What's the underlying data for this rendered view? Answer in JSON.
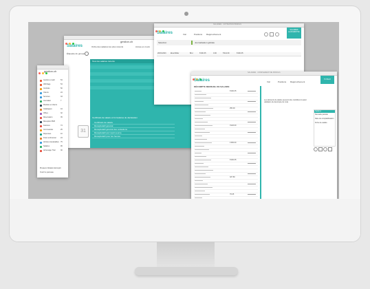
{
  "bg_color": "#e8e8e8",
  "accent": "#2fb5ad",
  "sidebar": {
    "logo": "gestion.ch",
    "items": [
      {
        "label": "Gestion et salir",
        "color": "#e8522d",
        "count": "54"
      },
      {
        "label": "Affichage",
        "color": "#e8522d",
        "count": "54"
      },
      {
        "label": "Contrats",
        "color": "#f39c12",
        "count": "50"
      },
      {
        "label": "Clients",
        "color": "#3498db",
        "count": "24"
      },
      {
        "label": "Services",
        "color": "#3498db",
        "count": "33"
      },
      {
        "label": "Journalier",
        "color": "#27ae60",
        "count": "7"
      },
      {
        "label": "Modules et clients",
        "color": "#2c3e50",
        "count": ""
      },
      {
        "label": "Catalogues",
        "color": "#e67e22",
        "count": "44"
      },
      {
        "label": "Offres",
        "color": "#9b59b6",
        "count": "32"
      },
      {
        "label": "Réservation",
        "color": "#e74c3c",
        "count": "35"
      },
      {
        "label": "Réception BVR",
        "color": "#2c3e50",
        "count": ""
      },
      {
        "label": "Factures",
        "color": "#e74c3c",
        "count": "74"
      },
      {
        "label": "Commandes",
        "color": "#f39c12",
        "count": "25"
      },
      {
        "label": "Dépenses",
        "color": "#16a085",
        "count": "10"
      },
      {
        "label": "Frais rembourser",
        "color": "#e67e22",
        "count": "24"
      },
      {
        "label": "Articles inévaluables",
        "color": "#3498db",
        "count": "75"
      },
      {
        "label": "Salaires",
        "color": "#27ae60",
        "count": "96"
      },
      {
        "label": "Adressage Trial",
        "color": "#e74c3c",
        "count": "30"
      }
    ],
    "footer": "Plusieurs Rotation Entrepôt",
    "footer2": "Ouvrir le panneau"
  },
  "win_back": {
    "logo": "gestion.ch",
    "title": "Salaires",
    "header_cols": [
      "Étiquette du groupe",
      "Ordre des salaires les plus récents",
      "Année en cours"
    ],
    "list_header": "Tous les salaires récents",
    "section": "Certificats de salaire et formulaires de déclaration",
    "items": [
      "Certificats de salaire",
      "Récapitulatif général",
      "Récapitulatif général des cotisations",
      "Récapitulatif par impôt source",
      "Récapitulatif pour les heures"
    ],
    "calendar_day": "31"
  },
  "win_top": {
    "title_bar": "SALAIRES · COTISATION PROFILS",
    "title": "Salaires",
    "tabs": [
      "Voir",
      "Positions",
      "Rapprochement"
    ],
    "badge": "SALAIRES AUJOURD'HUI",
    "filter_label": "Sélection",
    "filter_value": "Journalisation globale",
    "side_tabs": [
      "Périodiques",
      "Récents",
      "Clôturés",
      "Export"
    ],
    "row": [
      "26/01/2023",
      "Elsa Müller",
      "Brut",
      "6'190.35",
      "0.00",
      "5'412.60",
      "6'190.35"
    ]
  },
  "win_front": {
    "title_bar": "SALAIRES · COMPLÉMENT DE PROFILS",
    "title": "Salaires",
    "tabs": [
      "Voir",
      "Positions",
      "Rapprochement"
    ],
    "badge": "TOTAUX",
    "record_title": "DÉCOMPTE MENSUEL DE SALAIRE",
    "side_heading": "Salaires",
    "side_items": [
      "Nouvelle période",
      "Date de comptabilisation",
      "Fiche de salaire"
    ],
    "notes": "Les éléments de salaire peuvent être contrôlés ici avant validation du décompte du mois",
    "amounts": [
      "6'190.35",
      "250.00",
      "3'120.00",
      "1'450.00",
      "6'190.35",
      "327.80",
      "76.05",
      "1'284.60",
      "78.05",
      "6'212.45"
    ]
  }
}
